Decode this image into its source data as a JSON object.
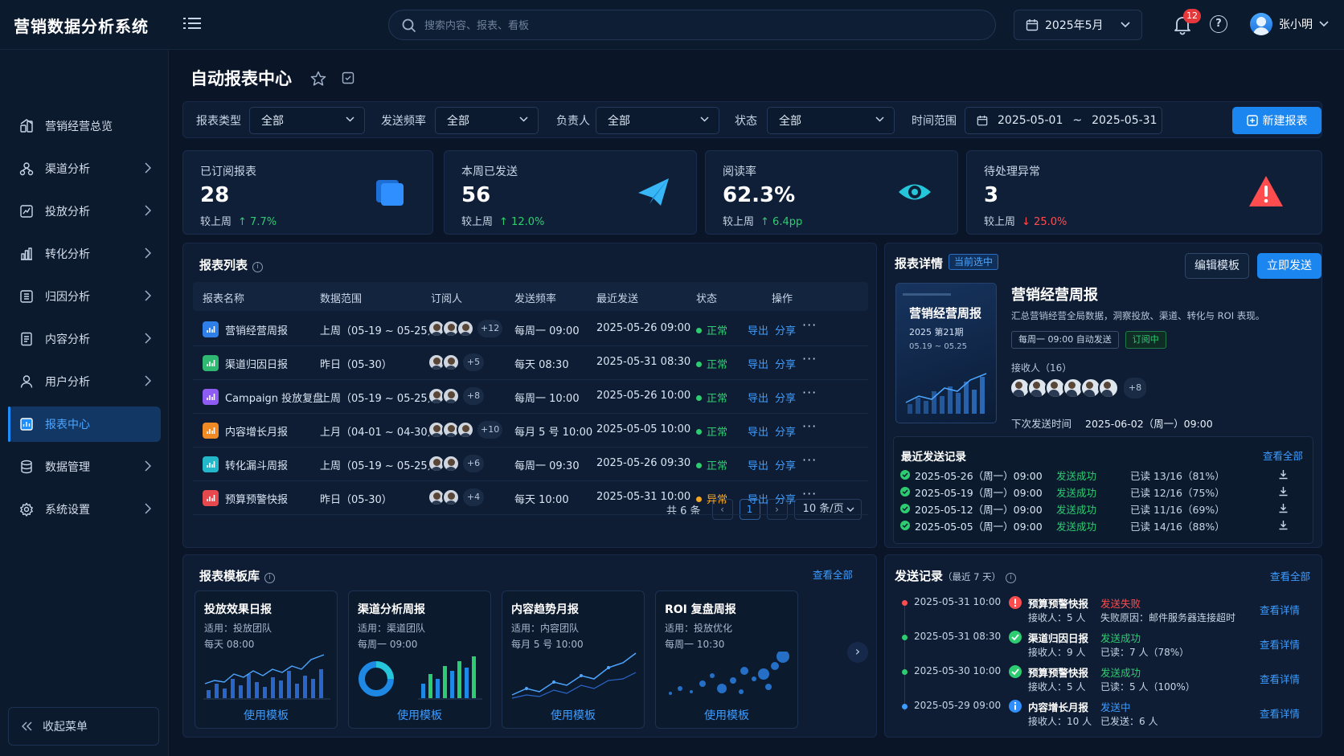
{
  "app": {
    "title": "营销数据分析系统"
  },
  "search": {
    "placeholder": "搜索内容、报表、看板"
  },
  "header": {
    "month": "2025年5月",
    "notifications": "12",
    "user": "张小明"
  },
  "sidebar": {
    "items": [
      {
        "label": "营销经营总览",
        "icon": "home-grid-icon",
        "chevron": false
      },
      {
        "label": "渠道分析",
        "icon": "channel-icon",
        "chevron": true
      },
      {
        "label": "投放分析",
        "icon": "chart-box-icon",
        "chevron": true
      },
      {
        "label": "转化分析",
        "icon": "bar-chart-icon",
        "chevron": true
      },
      {
        "label": "归因分析",
        "icon": "grid-box-icon",
        "chevron": true
      },
      {
        "label": "内容分析",
        "icon": "document-icon",
        "chevron": true
      },
      {
        "label": "用户分析",
        "icon": "user-icon",
        "chevron": true
      },
      {
        "label": "报表中心",
        "icon": "report-icon",
        "chevron": false,
        "active": true
      },
      {
        "label": "数据管理",
        "icon": "database-icon",
        "chevron": true
      },
      {
        "label": "系统设置",
        "icon": "gear-icon",
        "chevron": true
      }
    ],
    "collapse": "收起菜单"
  },
  "page": {
    "title": "自动报表中心"
  },
  "filters": {
    "type_label": "报表类型",
    "type_value": "全部",
    "freq_label": "发送频率",
    "freq_value": "全部",
    "owner_label": "负责人",
    "owner_value": "全部",
    "status_label": "状态",
    "status_value": "全部",
    "range_label": "时间范围",
    "range_start": "2025-05-01",
    "range_sep": "~",
    "range_end": "2025-05-31",
    "new_button": "新建报表"
  },
  "kpis": [
    {
      "label": "已订阅报表",
      "value": "28",
      "cmp_label": "较上周",
      "delta": "7.7%",
      "dir": "up",
      "color": "#2f8fff"
    },
    {
      "label": "本周已发送",
      "value": "56",
      "cmp_label": "较上周",
      "delta": "12.0%",
      "dir": "up",
      "color": "#38b6f5"
    },
    {
      "label": "阅读率",
      "value": "62.3%",
      "cmp_label": "较上周",
      "delta": "6.4pp",
      "dir": "up",
      "color": "#26c6da"
    },
    {
      "label": "待处理异常",
      "value": "3",
      "cmp_label": "较上周",
      "delta": "25.0%",
      "dir": "down",
      "color": "#ff4d4f"
    }
  ],
  "report_list": {
    "title": "报表列表",
    "columns": [
      "报表名称",
      "数据范围",
      "订阅人",
      "发送频率",
      "最近发送",
      "状态",
      "操作"
    ],
    "rows": [
      {
        "name": "营销经营周报",
        "range": "上周（05-19 ~ 05-25）",
        "avatars": 3,
        "more": "+12",
        "freq": "每周一 09:00",
        "last": "2025-05-26 09:00",
        "status": "正常",
        "status_color": "#2ecc71",
        "icon_color": "#2f7fe8"
      },
      {
        "name": "渠道归因日报",
        "range": "昨日（05-30）",
        "avatars": 2,
        "more": "+5",
        "freq": "每天 08:30",
        "last": "2025-05-31 08:30",
        "status": "正常",
        "status_color": "#2ecc71",
        "icon_color": "#2eb872"
      },
      {
        "name": "Campaign 投放复盘",
        "range": "上周（05-19 ~ 05-25）",
        "avatars": 2,
        "more": "+8",
        "freq": "每周一 10:00",
        "last": "2025-05-26 10:00",
        "status": "正常",
        "status_color": "#2ecc71",
        "icon_color": "#8e5cf2"
      },
      {
        "name": "内容增长月报",
        "range": "上月（04-01 ~ 04-30）",
        "avatars": 3,
        "more": "+10",
        "freq": "每月 5 号 10:00",
        "last": "2025-05-05 10:00",
        "status": "正常",
        "status_color": "#2ecc71",
        "icon_color": "#f08a24"
      },
      {
        "name": "转化漏斗周报",
        "range": "上周（05-19 ~ 05-25）",
        "avatars": 2,
        "more": "+6",
        "freq": "每周一 09:30",
        "last": "2025-05-26 09:30",
        "status": "正常",
        "status_color": "#2ecc71",
        "icon_color": "#22b8c9"
      },
      {
        "name": "预算预警快报",
        "range": "昨日（05-30）",
        "avatars": 2,
        "more": "+4",
        "freq": "每天 10:00",
        "last": "2025-05-31 10:00",
        "status": "异常",
        "status_color": "#f5a623",
        "icon_color": "#e5484d"
      }
    ],
    "export": "导出",
    "share": "分享",
    "total": "共 6 条",
    "page": "1",
    "page_size": "10 条/页"
  },
  "detail": {
    "title": "报表详情",
    "badge": "当前选中",
    "edit_btn": "编辑模板",
    "send_btn": "立即发送",
    "thumb_title": "营销经营周报",
    "thumb_sub": "2025 第21期",
    "thumb_range": "05.19 ~ 05.25",
    "name": "营销经营周报",
    "desc": "汇总营销经营全局数据，洞察投放、渠道、转化与 ROI 表现。",
    "tag_schedule": "每周一 09:00 自动发送",
    "tag_sub": "订阅中",
    "recipients_label": "接收人（16）",
    "recipients_more": "+8",
    "next_label": "下次发送时间",
    "next_value": "2025-06-02（周一）09:00"
  },
  "recent": {
    "title": "最近发送记录",
    "view_all": "查看全部",
    "rows": [
      {
        "time": "2025-05-26（周一）09:00",
        "status": "发送成功",
        "read": "已读 13/16（81%）"
      },
      {
        "time": "2025-05-19（周一）09:00",
        "status": "发送成功",
        "read": "已读 12/16（75%）"
      },
      {
        "time": "2025-05-12（周一）09:00",
        "status": "发送成功",
        "read": "已读 11/16（69%）"
      },
      {
        "time": "2025-05-05（周一）09:00",
        "status": "发送成功",
        "read": "已读 14/16（88%）"
      }
    ]
  },
  "templates": {
    "title": "报表模板库",
    "view_all": "查看全部",
    "cards": [
      {
        "name": "投放效果日报",
        "scope": "适用：投放团队",
        "freq": "每天 08:00",
        "use": "使用模板",
        "kind": "bar-line"
      },
      {
        "name": "渠道分析周报",
        "scope": "适用：渠道团队",
        "freq": "每周一 09:00",
        "use": "使用模板",
        "kind": "donut-bar"
      },
      {
        "name": "内容趋势月报",
        "scope": "适用：内容团队",
        "freq": "每月 5 号 10:00",
        "use": "使用模板",
        "kind": "line"
      },
      {
        "name": "ROI 复盘周报",
        "scope": "适用：投放优化",
        "freq": "每周一 10:30",
        "use": "使用模板",
        "kind": "scatter"
      }
    ]
  },
  "send_log": {
    "title": "发送记录",
    "subtitle": "（最近 7 天）",
    "view_all": "查看全部",
    "rows": [
      {
        "time": "2025-05-31 10:00",
        "name": "预算预警快报",
        "status": "发送失败",
        "status_color": "#ff4d4f",
        "icon": "alert",
        "line1": "接收人：5 人",
        "line2": "失败原因：邮件服务器连接超时",
        "detail": "查看详情",
        "dot": "#ff4d4f"
      },
      {
        "time": "2025-05-31 08:30",
        "name": "渠道归因日报",
        "status": "发送成功",
        "status_color": "#2ecc71",
        "icon": "ok",
        "line1": "接收人：9 人",
        "line2": "已读：7 人（78%）",
        "detail": "查看详情",
        "dot": "#2ecc71"
      },
      {
        "time": "2025-05-30 10:00",
        "name": "预算预警快报",
        "status": "发送成功",
        "status_color": "#2ecc71",
        "icon": "ok",
        "line1": "接收人：5 人",
        "line2": "已读：5 人（100%）",
        "detail": "查看详情",
        "dot": "#2ecc71"
      },
      {
        "time": "2025-05-29 09:00",
        "name": "内容增长月报",
        "status": "发送中",
        "status_color": "#3d9cff",
        "icon": "info",
        "line1": "接收人：10 人",
        "line2": "已发送：6 人",
        "detail": "查看详情",
        "dot": "#3d9cff"
      }
    ]
  }
}
